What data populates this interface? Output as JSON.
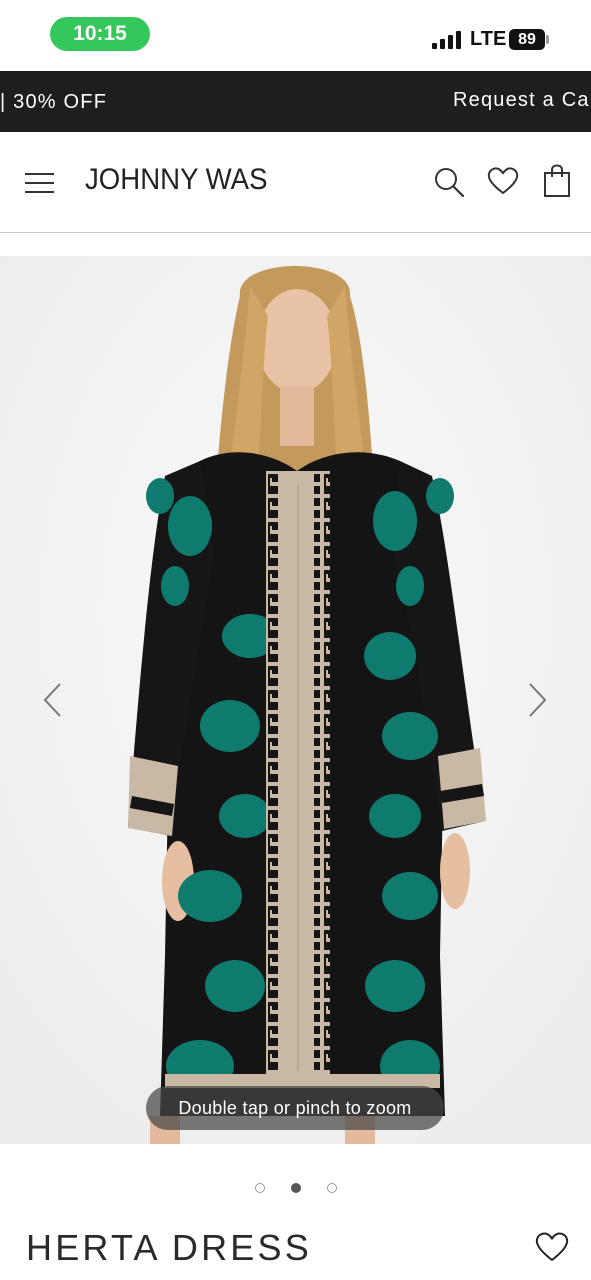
{
  "status": {
    "time": "10:15",
    "network": "LTE",
    "battery": "89"
  },
  "promo": {
    "left_text": "| 30% OFF",
    "right_text": "Request a Ca"
  },
  "header": {
    "brand": "JOHNNY WAS",
    "icons": [
      "menu-icon",
      "search-icon",
      "heart-icon",
      "shopping-bag-icon"
    ]
  },
  "gallery": {
    "zoom_hint": "Double tap or pinch to zoom",
    "slide_count": 3,
    "active_slide": 2
  },
  "product": {
    "title": "HERTA DRESS"
  },
  "colors": {
    "status_green": "#34c759",
    "banner_bg": "#1e1e1e",
    "dress_black": "#141414",
    "dress_teal": "#0f7a6e",
    "trim_beige": "#c9b8a4"
  }
}
